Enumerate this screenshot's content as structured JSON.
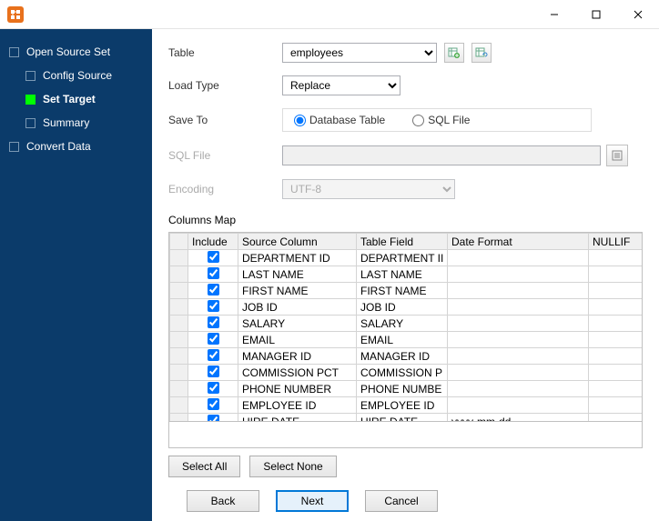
{
  "sidebar": {
    "items": [
      {
        "label": "Open Source Set"
      },
      {
        "label": "Config Source"
      },
      {
        "label": "Set Target"
      },
      {
        "label": "Summary"
      },
      {
        "label": "Convert Data"
      }
    ]
  },
  "form": {
    "table_label": "Table",
    "table_value": "employees",
    "loadtype_label": "Load Type",
    "loadtype_value": "Replace",
    "saveto_label": "Save To",
    "saveto_db": "Database Table",
    "saveto_sql": "SQL File",
    "sqlfile_label": "SQL File",
    "sqlfile_value": "",
    "encoding_label": "Encoding",
    "encoding_value": "UTF-8",
    "columns_label": "Columns Map"
  },
  "grid": {
    "headers": {
      "include": "Include",
      "source": "Source Column",
      "field": "Table Field",
      "date": "Date Format",
      "nullif": "NULLIF"
    },
    "rows": [
      {
        "include": true,
        "source": "DEPARTMENT ID",
        "field": "DEPARTMENT II",
        "date": "",
        "nullif": ""
      },
      {
        "include": true,
        "source": "LAST NAME",
        "field": "LAST NAME",
        "date": "",
        "nullif": ""
      },
      {
        "include": true,
        "source": "FIRST NAME",
        "field": "FIRST NAME",
        "date": "",
        "nullif": ""
      },
      {
        "include": true,
        "source": "JOB ID",
        "field": "JOB ID",
        "date": "",
        "nullif": ""
      },
      {
        "include": true,
        "source": "SALARY",
        "field": "SALARY",
        "date": "",
        "nullif": ""
      },
      {
        "include": true,
        "source": "EMAIL",
        "field": "EMAIL",
        "date": "",
        "nullif": ""
      },
      {
        "include": true,
        "source": "MANAGER ID",
        "field": "MANAGER ID",
        "date": "",
        "nullif": ""
      },
      {
        "include": true,
        "source": "COMMISSION PCT",
        "field": "COMMISSION P",
        "date": "",
        "nullif": ""
      },
      {
        "include": true,
        "source": "PHONE NUMBER",
        "field": "PHONE NUMBE",
        "date": "",
        "nullif": ""
      },
      {
        "include": true,
        "source": "EMPLOYEE ID",
        "field": "EMPLOYEE ID",
        "date": "",
        "nullif": ""
      },
      {
        "include": true,
        "source": "HIRE DATE",
        "field": "HIRE DATE",
        "date": "yyyy-mm-dd",
        "nullif": ""
      }
    ]
  },
  "buttons": {
    "select_all": "Select All",
    "select_none": "Select None",
    "back": "Back",
    "next": "Next",
    "cancel": "Cancel"
  }
}
